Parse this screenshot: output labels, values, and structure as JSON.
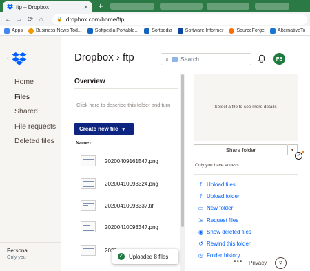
{
  "browser": {
    "tab_title": "ftp – Dropbox",
    "tab_close": "✕",
    "new_tab": "+",
    "url": "dropbox.com/home/ftp"
  },
  "bookmarks": [
    {
      "label": "Apps",
      "color": "#4285f4"
    },
    {
      "label": "Business News Tod...",
      "color": "#f29900"
    },
    {
      "label": "Softpedia Portable...",
      "color": "#1565c0"
    },
    {
      "label": "Softpedia",
      "color": "#1565c0"
    },
    {
      "label": "Software Informer",
      "color": "#0d47a1"
    },
    {
      "label": "SourceForge",
      "color": "#ff6d00"
    },
    {
      "label": "AlternativeTo",
      "color": "#1976d2"
    }
  ],
  "sidebar": {
    "items": [
      {
        "label": "Home"
      },
      {
        "label": "Files"
      },
      {
        "label": "Shared"
      },
      {
        "label": "File requests"
      },
      {
        "label": "Deleted files"
      }
    ],
    "account_title": "Personal",
    "account_sub": "Only you"
  },
  "header": {
    "breadcrumb": "Dropbox › ftp",
    "search_placeholder": "Search",
    "avatar_initials": "FS"
  },
  "overview": {
    "title": "Overview",
    "description_placeholder": "Click here to describe this folder and turn"
  },
  "create_button": "Create new file",
  "table": {
    "name_header": "Name",
    "sort_arrow": "↑",
    "files": [
      {
        "name": "20200409161547.png"
      },
      {
        "name": "20200410093324.png"
      },
      {
        "name": "20200410093337.tif"
      },
      {
        "name": "20200410093347.png"
      },
      {
        "name": "2020"
      }
    ]
  },
  "details": {
    "preview_hint": "Select a file to see more details",
    "share_label": "Share folder",
    "access_text": "Only you have access",
    "actions": [
      {
        "label": "Upload files",
        "icon": "upload-icon"
      },
      {
        "label": "Upload folder",
        "icon": "upload-folder-icon"
      },
      {
        "label": "New folder",
        "icon": "new-folder-icon"
      },
      {
        "label": "Request files",
        "icon": "request-icon"
      },
      {
        "label": "Show deleted files",
        "icon": "eye-icon"
      },
      {
        "label": "Rewind this folder",
        "icon": "rewind-icon"
      },
      {
        "label": "Folder history",
        "icon": "history-icon"
      }
    ]
  },
  "toast": {
    "text": "Uploaded 8 files"
  },
  "footer": {
    "more": "•••",
    "privacy": "Privacy",
    "help": "?"
  },
  "colors": {
    "brand": "#0061fe",
    "primary_button": "#0d2481",
    "avatar": "#1f7a3f"
  }
}
